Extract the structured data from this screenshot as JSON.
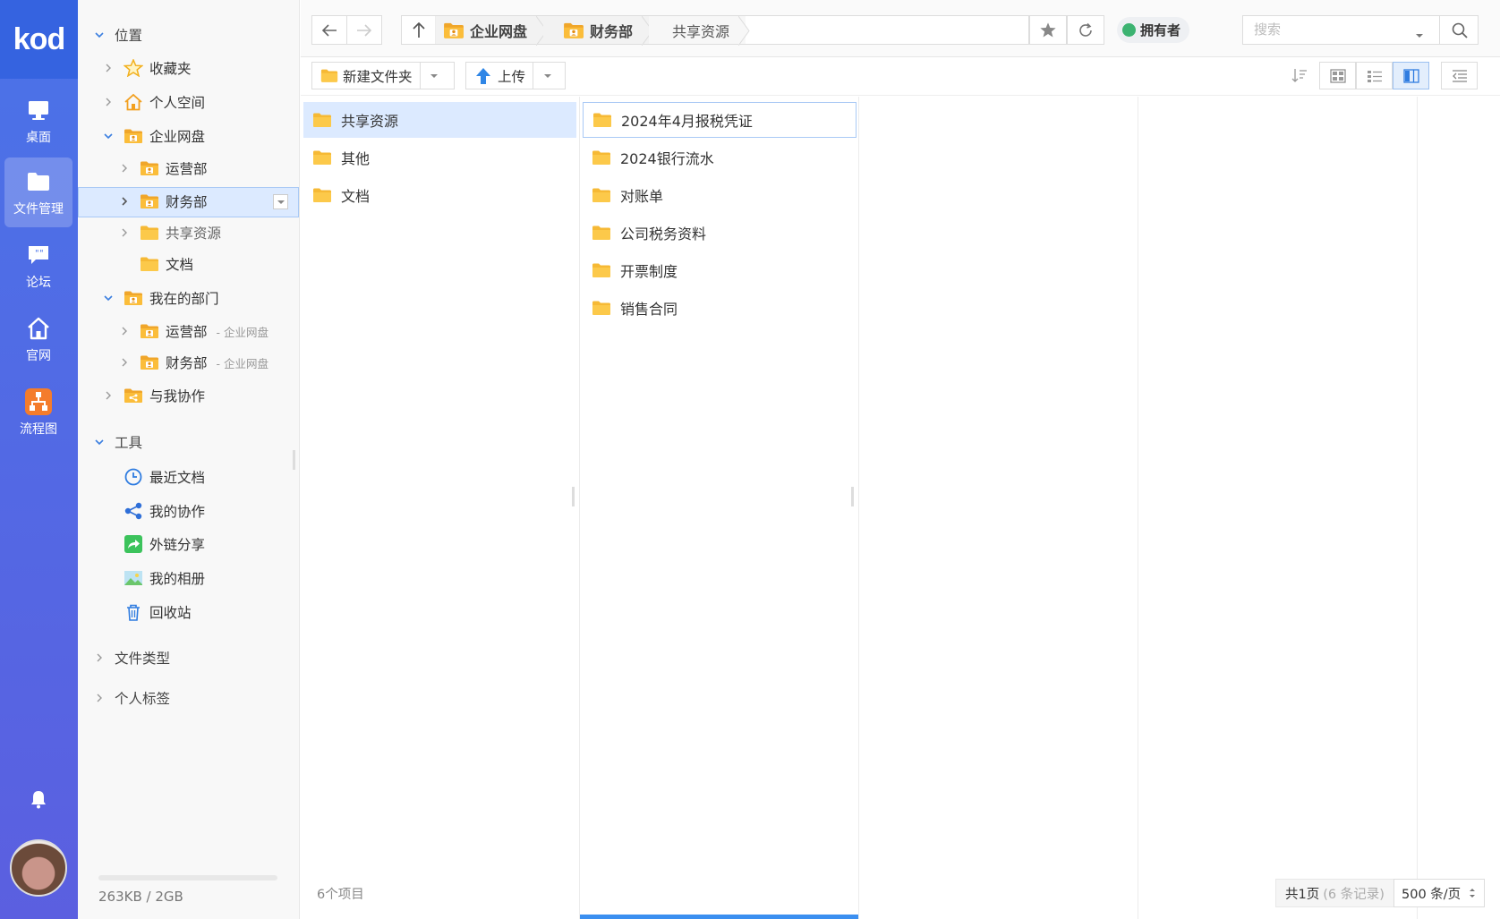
{
  "rail": {
    "logo": "kod",
    "items": [
      {
        "label": "桌面"
      },
      {
        "label": "文件管理"
      },
      {
        "label": "论坛"
      },
      {
        "label": "官网"
      },
      {
        "label": "流程图"
      }
    ]
  },
  "tree": {
    "location_label": "位置",
    "favorites": "收藏夹",
    "personal_space": "个人空间",
    "enterprise_disk": "企业网盘",
    "ops_dept": "运营部",
    "finance_dept": "财务部",
    "shared_resources": "共享资源",
    "documents": "文档",
    "my_depts": "我在的部门",
    "my_ops_dept": "运营部",
    "my_ops_sub": "- 企业网盘",
    "my_finance_dept": "财务部",
    "my_finance_sub": "- 企业网盘",
    "collab_with_me": "与我协作",
    "tools_label": "工具",
    "recent_docs": "最近文档",
    "my_collab": "我的协作",
    "link_share": "外链分享",
    "my_album": "我的相册",
    "recycle_bin": "回收站",
    "file_types": "文件类型",
    "personal_tags": "个人标签",
    "quota": "263KB / 2GB",
    "quota_used_fraction": 0.0001
  },
  "topbar": {
    "breadcrumbs": [
      "企业网盘",
      "财务部",
      "共享资源"
    ],
    "owner_label": "拥有者",
    "search_placeholder": "搜索"
  },
  "toolbar": {
    "new_folder": "新建文件夹",
    "upload": "上传"
  },
  "column1": {
    "items": [
      "共享资源",
      "其他",
      "文档"
    ]
  },
  "column2": {
    "items": [
      "2024年4月报税凭证",
      "2024银行流水",
      "对账单",
      "公司税务资料",
      "开票制度",
      "销售合同"
    ]
  },
  "footer": {
    "item_count": "6个项目",
    "pages": "共1页",
    "records": "(6 条记录)",
    "per_page": "500 条/页"
  },
  "colors": {
    "rail": "#4a73e8",
    "selection": "#dceaff",
    "folder": "#f6b935",
    "accent": "#3b8ff0"
  }
}
